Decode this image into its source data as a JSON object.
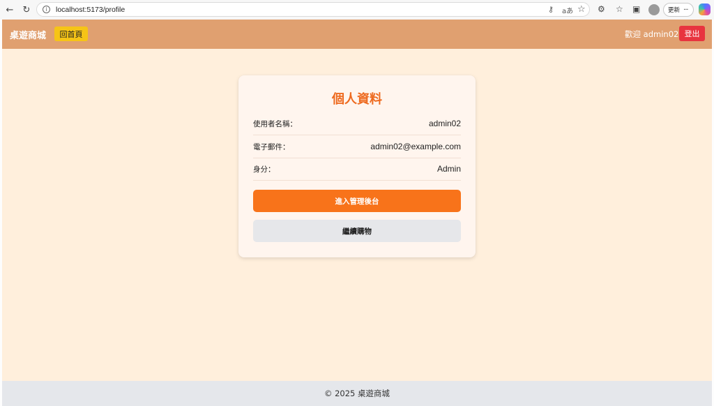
{
  "browser": {
    "url": "localhost:5173/profile",
    "update_label": "更新",
    "more_label": "···",
    "icons": [
      "back-arrow-icon",
      "reload-icon",
      "site-info-icon",
      "key-icon",
      "read-aloud-icon",
      "favorite-star-icon",
      "extensions-icon",
      "favorites-list-icon",
      "collections-icon",
      "profile-avatar-icon",
      "copilot-icon"
    ]
  },
  "header": {
    "brand": "桌遊商城",
    "home_label": "回首頁",
    "welcome": "歡迎 admin02",
    "logout_label": "登出"
  },
  "profile": {
    "title": "個人資料",
    "rows": [
      {
        "label": "使用者名稱：",
        "value": "admin02"
      },
      {
        "label": "電子郵件：",
        "value": "admin02@example.com"
      },
      {
        "label": "身分：",
        "value": "Admin"
      }
    ],
    "admin_button": "進入管理後台",
    "shop_button": "繼續購物"
  },
  "footer": {
    "text": "© 2025 桌遊商城"
  },
  "colors": {
    "header_bg": "#e0a070",
    "home_button": "#f6c416",
    "logout_button": "#e8343f",
    "page_bg": "#ffefdc",
    "card_bg": "#fff5ee",
    "title": "#ee6a1f",
    "primary_button": "#f8731a",
    "secondary_button": "#e6e7ea",
    "footer_bg": "#e5e7eb"
  }
}
